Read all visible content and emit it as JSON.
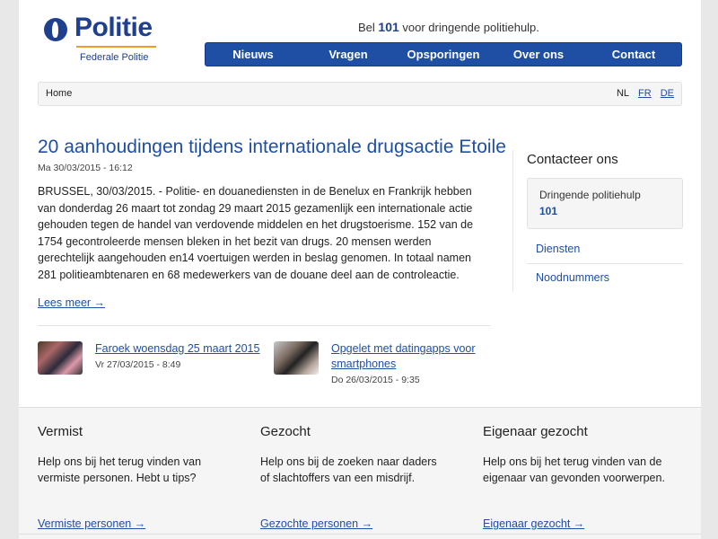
{
  "header": {
    "logo_text": "Politie",
    "logo_sub": "Federale Politie",
    "emergency_pre": "Bel",
    "emergency_num": "101",
    "emergency_post": "voor dringende politiehulp."
  },
  "nav": [
    "Nieuws",
    "Vragen",
    "Opsporingen",
    "Over ons",
    "Contact"
  ],
  "breadcrumb": {
    "home": "Home"
  },
  "languages": {
    "current": "NL",
    "others": [
      "FR",
      "DE"
    ]
  },
  "article": {
    "title": "20 aanhoudingen tijdens internationale drugsactie Etoile",
    "date": "Ma 30/03/2015 - 16:12",
    "body": "BRUSSEL, 30/03/2015. - Politie- en douanediensten in de Benelux en Frankrijk hebben van donderdag 26 maart tot zondag 29 maart 2015 gezamenlijk een internationale actie gehouden tegen de handel van verdovende middelen en het drugstoerisme. 152 van de 1754 gecontroleerde mensen bleken in het bezit van drugs. 20 mensen werden gerechtelijk aangehouden en14 voertuigen werden in beslag genomen. In totaal namen 281 politieambtenaren en 68 medewerkers van de douane deel aan de controleactie.",
    "read_more": "Lees meer →"
  },
  "teasers": [
    {
      "title": "Faroek woensdag 25 maart 2015",
      "date": "Vr 27/03/2015 - 8:49"
    },
    {
      "title": "Opgelet met datingapps voor smartphones",
      "date": "Do 26/03/2015 - 9:35"
    }
  ],
  "sidebar": {
    "heading": "Contacteer ons",
    "box_label": "Dringende politiehulp",
    "box_number": "101",
    "links": [
      "Diensten",
      "Noodnummers"
    ]
  },
  "footer": [
    {
      "heading": "Vermist",
      "text": "Help ons bij het terug vinden van vermiste personen. Hebt u tips?",
      "link": "Vermiste personen →"
    },
    {
      "heading": "Gezocht",
      "text": "Help ons bij de zoeken naar daders of slachtoffers van een misdrijf.",
      "link": "Gezochte personen →"
    },
    {
      "heading": "Eigenaar gezocht",
      "text": "Help ons bij het terug vinden van de eigenaar van gevonden voorwerpen.",
      "link": "Eigenaar gezocht →"
    }
  ],
  "colors": {
    "brand_blue": "#1f4ea5",
    "logo_blue": "#1f3f8f",
    "accent_orange": "#f39a26"
  }
}
